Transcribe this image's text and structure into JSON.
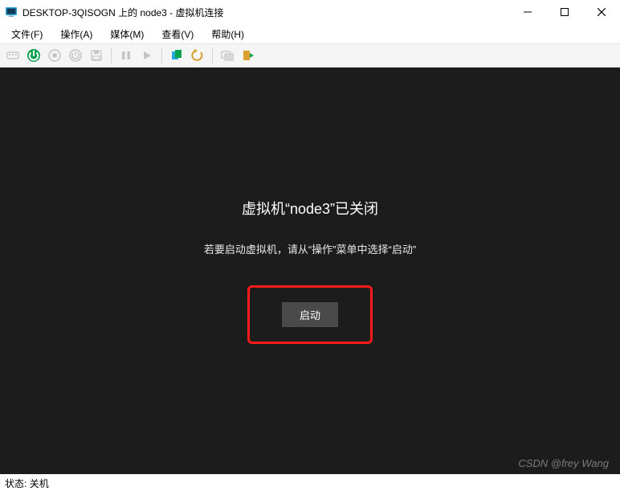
{
  "window": {
    "title": "DESKTOP-3QISOGN 上的 node3 - 虚拟机连接",
    "controls": {
      "min": "minimize",
      "max": "maximize",
      "close": "close"
    }
  },
  "menu": {
    "file": "文件(F)",
    "action": "操作(A)",
    "media": "媒体(M)",
    "view": "查看(V)",
    "help": "帮助(H)"
  },
  "toolbar": {
    "ctrl_alt_del": "Ctrl+Alt+Del",
    "start": "start",
    "turnoff": "turnoff",
    "shutdown": "shutdown",
    "save": "save",
    "pause": "pause",
    "reset": "reset",
    "checkpoint": "checkpoint",
    "revert": "revert",
    "enhanced": "enhanced-session",
    "share": "share"
  },
  "vm": {
    "heading": "虚拟机“node3”已关闭",
    "subtext": "若要启动虚拟机，请从“操作”菜单中选择“启动”",
    "start_label": "启动"
  },
  "status": {
    "label": "状态:",
    "value": "关机"
  },
  "watermark": "CSDN @frey Wang"
}
